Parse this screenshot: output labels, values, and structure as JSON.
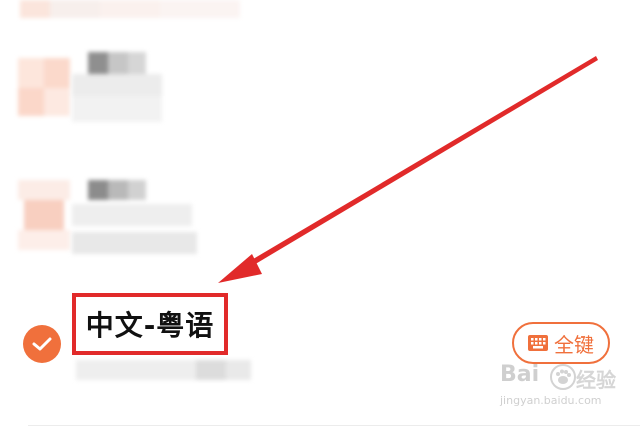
{
  "selected_language": {
    "title": "中文-粤语"
  },
  "keyboard_button": {
    "label": "全键"
  },
  "watermark": {
    "brand": "Bai",
    "brand_suffix": "经验",
    "url": "jingyan.baidu.com"
  },
  "colors": {
    "accent": "#f0703c",
    "highlight_box": "#e12a2a",
    "arrow": "#e12a2a"
  },
  "icons": {
    "check": "checkmark-icon",
    "keyboard": "keyboard-icon"
  }
}
